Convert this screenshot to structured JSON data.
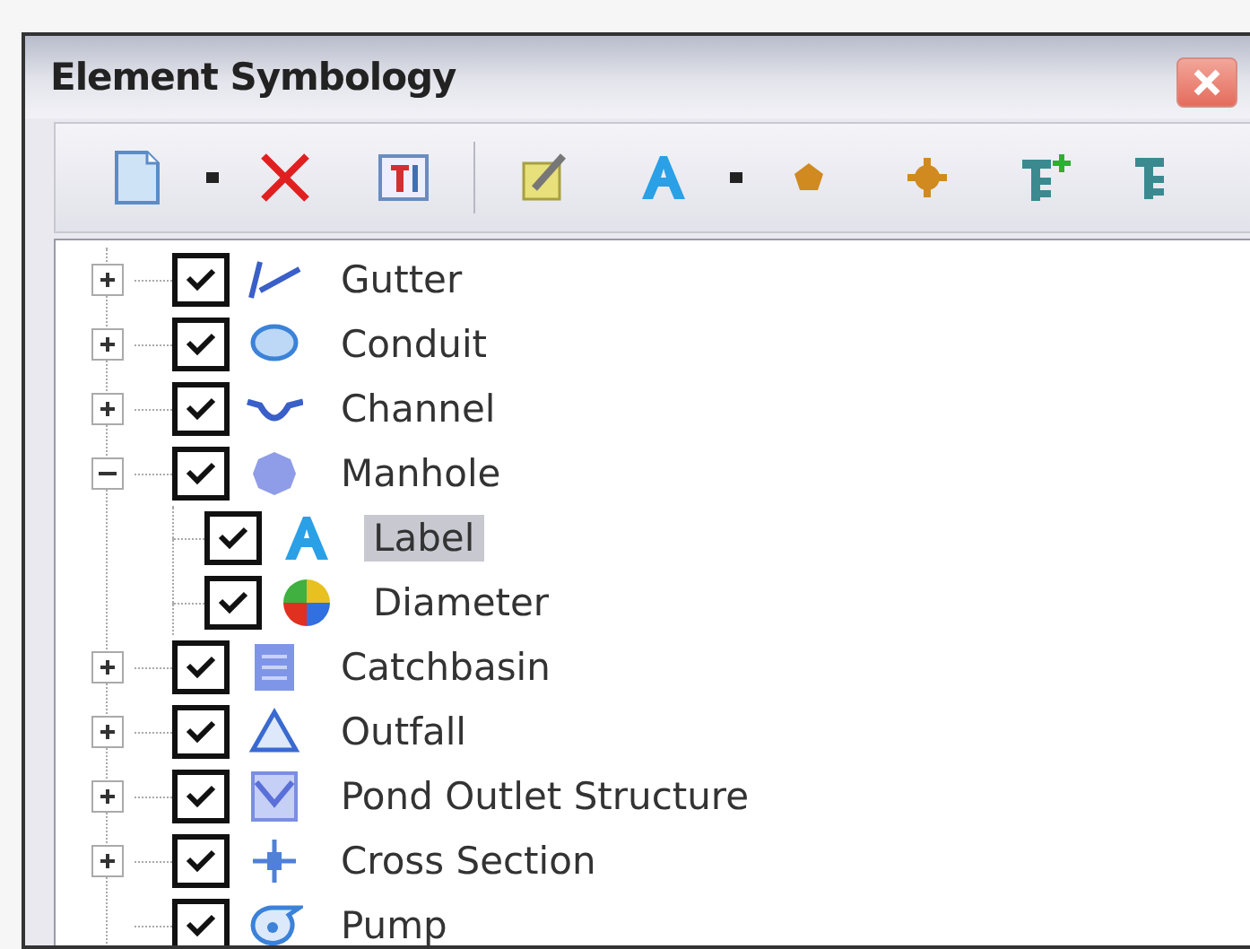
{
  "window": {
    "title": "Element Symbology"
  },
  "toolbar": [
    {
      "kind": "new"
    },
    {
      "kind": "caret"
    },
    {
      "kind": "delete"
    },
    {
      "kind": "textbox"
    },
    {
      "kind": "separator"
    },
    {
      "kind": "edit"
    },
    {
      "kind": "label"
    },
    {
      "kind": "caret"
    },
    {
      "kind": "pentagon"
    },
    {
      "kind": "gear"
    },
    {
      "kind": "tree-add"
    },
    {
      "kind": "tree"
    }
  ],
  "tree": {
    "items": [
      {
        "label": "Gutter",
        "kind": "gutter",
        "checked": true,
        "expanded": false,
        "selected": false
      },
      {
        "label": "Conduit",
        "kind": "conduit",
        "checked": true,
        "expanded": false,
        "selected": false
      },
      {
        "label": "Channel",
        "kind": "channel",
        "checked": true,
        "expanded": false,
        "selected": false
      },
      {
        "label": "Manhole",
        "kind": "manhole",
        "checked": true,
        "expanded": true,
        "selected": false,
        "children": [
          {
            "label": "Label",
            "kind": "label",
            "checked": true,
            "selected": true
          },
          {
            "label": "Diameter",
            "kind": "pie",
            "checked": true,
            "selected": false
          }
        ]
      },
      {
        "label": "Catchbasin",
        "kind": "catchbasin",
        "checked": true,
        "expanded": false,
        "selected": false
      },
      {
        "label": "Outfall",
        "kind": "outfall",
        "checked": true,
        "expanded": false,
        "selected": false
      },
      {
        "label": "Pond Outlet Structure",
        "kind": "pond",
        "checked": true,
        "expanded": false,
        "selected": false
      },
      {
        "label": "Cross Section",
        "kind": "cross",
        "checked": true,
        "expanded": false,
        "selected": false
      },
      {
        "label": "Pump",
        "kind": "pump",
        "checked": true,
        "selected": false
      }
    ]
  }
}
